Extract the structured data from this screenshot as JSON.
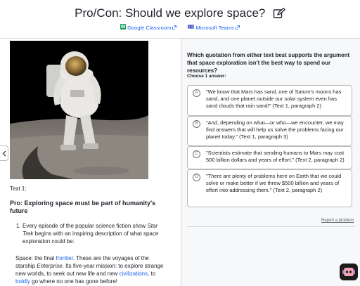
{
  "header": {
    "title": "Pro/Con: Should we explore space?",
    "google_classroom": "Google Classroom",
    "microsoft_teams": "Microsoft Teams"
  },
  "article": {
    "text_label": "Text 1:",
    "heading": "Pro: Exploring space must be part of humanity's future",
    "paragraph_number": "1.",
    "paragraph_parts": {
      "before_italic": "Every episode of the popular science fiction show ",
      "italic": "Star Trek",
      "after_italic": " begins with an inspiring description of what space exploration could be:"
    },
    "quote_parts": {
      "p1": "Space: the final ",
      "link1": "frontier",
      "p2": ". These are the voyages of the starship ",
      "italic": "Enterprise",
      "p3": ". Its five-year mission: to explore strange new worlds, to seek out new life and new ",
      "link2": "civilizations",
      "p4": ", to ",
      "link3": "boldly",
      "p5": " go where no one has gone before!"
    }
  },
  "question": {
    "prompt": "Which quotation from either text best supports the argument that space exploration isn't the best way to spend our resources?",
    "choose_label": "Choose 1 answer:",
    "choices": [
      {
        "letter": "A",
        "text": "\"We know that Mars has sand, one of Saturn's moons has sand, and one planet outside our solar system even has sand clouds that rain sand!\" (Text 1, paragraph 2)"
      },
      {
        "letter": "B",
        "text": "\"And, depending on what—or who—we encounter, we may find answers that will help us solve the problems facing our planet today.\" (Text 1, paragraph 3)"
      },
      {
        "letter": "C",
        "text": "\"Scientists estimate that sending humans to Mars may cost 500 billion dollars and years of effort.\" (Text 2, paragraph 2)"
      },
      {
        "letter": "D",
        "text": "\"There are plenty of problems here on Earth that we could solve or make better if we threw $500 billion and years of effort into addressing them.\" (Text 2, paragraph 2)"
      }
    ],
    "report_link": "Report a problem"
  },
  "colors": {
    "link": "#1865f2",
    "border": "#d6d8da",
    "panel_bg": "#f7f8fa"
  },
  "icons": [
    "edit-icon",
    "google-classroom-icon",
    "microsoft-teams-icon",
    "external-link-icon",
    "chevron-left-icon",
    "hint-avatar-icon"
  ]
}
